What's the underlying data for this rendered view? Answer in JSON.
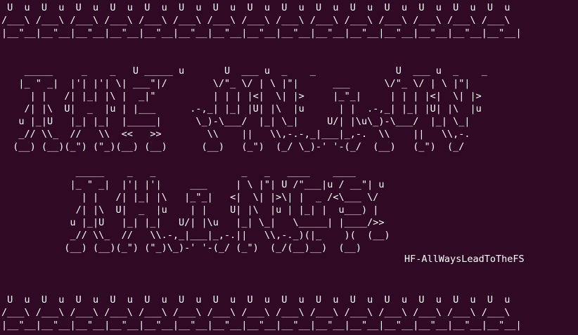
{
  "terminal": {
    "border_top": " U  u  U  u  U  u  U  u  U  u  U  u  U  u  U  u  U  u  U  u  U  u  U  u  U  u  U  u  U  u\n/___\\ /___\\ /___\\ /___\\ /___\\ /___\\ /___\\ /___\\ /___\\ /___\\ /___\\ /___\\ /___\\ /___\\ /___\\\n|__\"__|__\"__|__\"__|__\"__|__\"__|__\"__|__\"__|__\"__|__\"__|__\"__|__\"__|__\"__|__\"__|__\"__|__\"__|",
    "title_art": "    _____     _    _   U _____ u       U  ___ u  _    _              U  ___ u  _    _\n   |_ \" _|  |'| |'| \\| ___\"|/        \\/\"_ \\/ | \\ |\"|      ___      \\/\"_ \\/ | \\ |\"|\n     | |   /| |_| |\\ |  _|\"          | | | |<|  \\| |>     |_\"_|     | | | |<|  \\| |>\n    /| |\\  U|  _  |u | |___      .-,_| |_| |U| |\\  |u      | |  .-,_| |_| |U| |\\  |u\n   u |_|U   |_| |_|  |_____|      \\_)-\\___/  |_| \\_|     U/| |\\u\\_)-\\___/  |_| \\_|\n   _// \\\\_  //   \\\\  <<   >>        \\\\    ||   \\\\,-.-,_|___|_,-.  \\\\    ||   \\\\,-.\n  (__) (__)(_\") (\"_)(__) (__)      (__)   (_\")  (_/ \\_)-' '-(_/  (__)   (_\")  (_/\n\n             _____    _   _               _   _   ____    ____\n            |_ \" _|  |'| |'|     ___     | \\ |\"| U /\"___|u / __\"| u\n              | |   /| |_| |\\   |_\"_|   <|  \\| |>\\| |  _ /<\\___ \\/\n             /| |\\  U|  _  |u    | |    U| |\\  |u | |_| |  u___) |\n            u |_|U   |_| |_|   U/| |\\u   |_| \\_|   \\_____| |____/>>\n            _// \\\\_  //   \\\\.-,_|___|_,-.||   \\\\,-._)(|_    )(  (__)\n           (__) (__)(_\") (\"_)\\_)-' '-(_/ (_\")  (_/(__)__)  (__)",
    "signature": "HF-AllWaysLeadToTheFS",
    "border_bottom": " U  u  U  u  U  u  U  u  U  u  U  u  U  u  U  u  U  u  U  u  U  u  U  u  U  u  U  u  U  u\n/___\\ /___\\ /___\\ /___\\ /___\\ /___\\ /___\\ /___\\ /___\\ /___\\ /___\\ /___\\ /___\\ /___\\ /___\\\n|__\"__|__\"__|__\"__|__\"__|__\"__|__\"__|__\"__|__\"__|__\"__|__\"__|__\"__|__\"__|__\"__|__\"__|__\"__|"
  }
}
